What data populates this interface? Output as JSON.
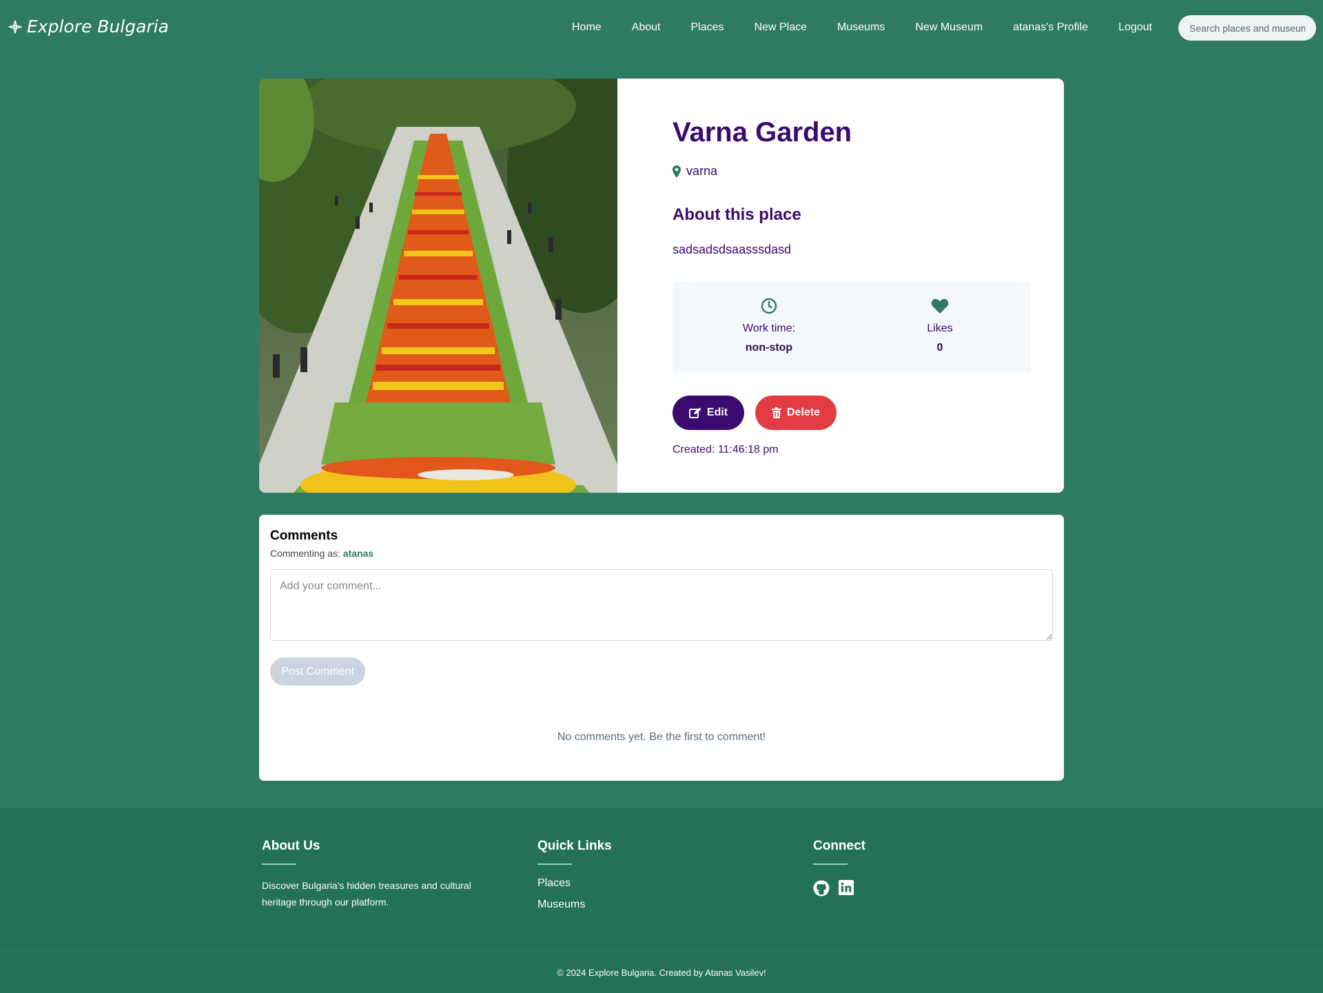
{
  "nav": {
    "logo": "Explore Bulgaria",
    "links": [
      "Home",
      "About",
      "Places",
      "New Place",
      "Museums",
      "New Museum",
      "atanas's Profile",
      "Logout"
    ],
    "search_placeholder": "Search places and museums..."
  },
  "place": {
    "title": "Varna Garden",
    "location": "varna",
    "about_heading": "About this place",
    "description": "sadsadsdsaasssdasd",
    "work_time_label": "Work time:",
    "work_time_value": "non-stop",
    "likes_label": "Likes",
    "likes_value": "0",
    "edit_label": "Edit",
    "delete_label": "Delete",
    "created": "Created: 11:46:18 pm"
  },
  "comments": {
    "title": "Comments",
    "commenting_as_label": "Commenting as:",
    "user": "atanas",
    "placeholder": "Add your comment...",
    "post_label": "Post Comment",
    "empty_text": "No comments yet. Be the first to comment!"
  },
  "footer": {
    "about_title": "About Us",
    "about_text": "Discover Bulgaria's hidden treasures and cultural heritage through our platform.",
    "quick_title": "Quick Links",
    "quick_links": [
      "Places",
      "Museums"
    ],
    "connect_title": "Connect",
    "connect_icons": [
      "github-icon",
      "linkedin-icon"
    ],
    "copyright": "© 2024 Explore Bulgaria. Created by Atanas Vasilev!"
  },
  "colors": {
    "page_bg": "#2e7a63",
    "footer_bg": "#237157",
    "primary_purple": "#3b0a6f",
    "delete_red": "#e23c42"
  }
}
